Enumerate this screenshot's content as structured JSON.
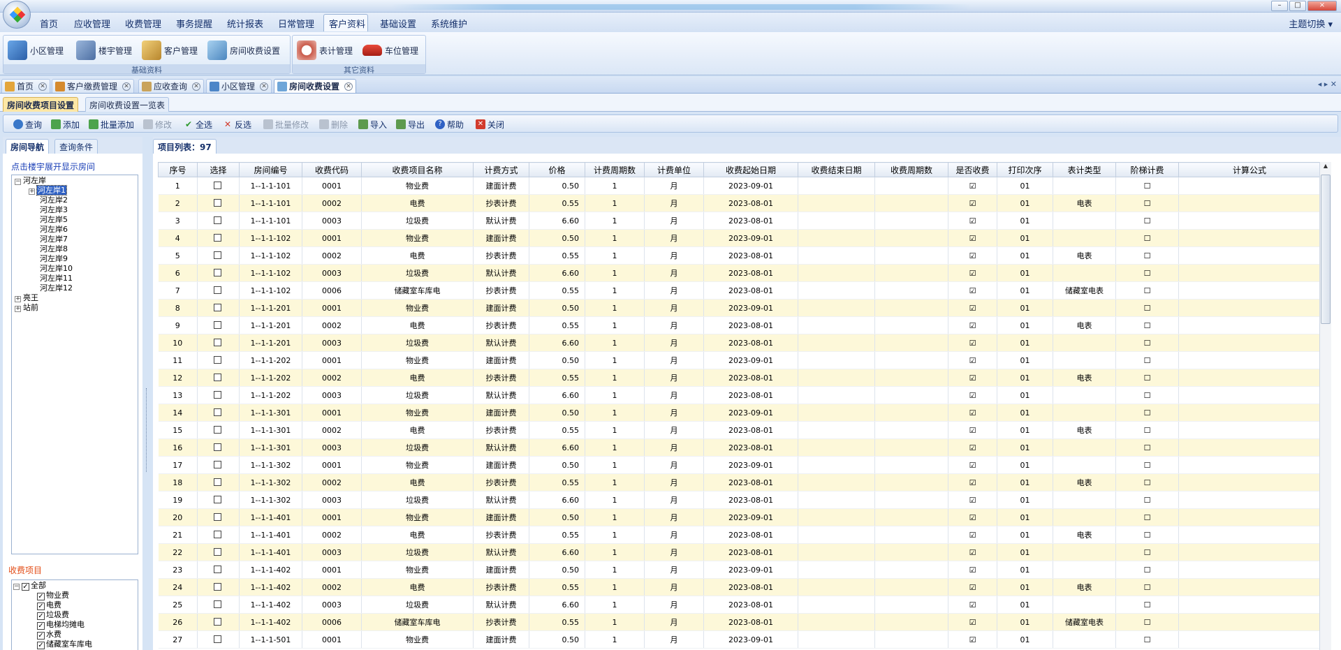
{
  "window": {
    "title": "",
    "buttons": [
      "–",
      "□",
      "×"
    ]
  },
  "menu": {
    "items": [
      "首页",
      "应收管理",
      "收费管理",
      "事务提醒",
      "统计报表",
      "日常管理",
      "客户资料",
      "基础设置",
      "系统维护"
    ],
    "active": "客户资料",
    "theme_switch": "主题切换 ▾"
  },
  "ribbon": {
    "groups": [
      {
        "label": "基础资料",
        "buttons": [
          "小区管理",
          "楼宇管理",
          "客户管理",
          "房间收费设置"
        ]
      },
      {
        "label": "其它资料",
        "buttons": [
          "表计管理",
          "车位管理"
        ]
      }
    ]
  },
  "doc_tabs": [
    "首页",
    "客户缴费管理",
    "应收查询",
    "小区管理",
    "房间收费设置"
  ],
  "doc_tab_close": "✕",
  "doc_nav": "◂ ▸ ✕",
  "sub_tabs": [
    "房间收费项目设置",
    "房间收费设置一览表"
  ],
  "toolbar": {
    "buttons": [
      {
        "label": "查询",
        "enabled": true,
        "icon": "search-icon"
      },
      {
        "label": "添加",
        "enabled": true,
        "icon": "add-icon"
      },
      {
        "label": "批量添加",
        "enabled": true,
        "icon": "batch-add-icon"
      },
      {
        "label": "修改",
        "enabled": false,
        "icon": "edit-icon"
      },
      {
        "label": "全选",
        "enabled": true,
        "icon": "check-icon"
      },
      {
        "label": "反选",
        "enabled": true,
        "icon": "invert-icon"
      },
      {
        "label": "批量修改",
        "enabled": false,
        "icon": "batch-edit-icon"
      },
      {
        "label": "删除",
        "enabled": false,
        "icon": "delete-icon"
      },
      {
        "label": "导入",
        "enabled": true,
        "icon": "import-icon"
      },
      {
        "label": "导出",
        "enabled": true,
        "icon": "export-icon"
      },
      {
        "label": "帮助",
        "enabled": true,
        "icon": "help-icon"
      },
      {
        "label": "关闭",
        "enabled": true,
        "icon": "close-icon"
      }
    ]
  },
  "left_panel": {
    "tabs": [
      "房间导航",
      "查询条件"
    ],
    "hint": "点击楼宇展开显示房间",
    "tree": {
      "root": "河左岸",
      "children": [
        "河左岸1",
        "河左岸2",
        "河左岸3",
        "河左岸5",
        "河左岸6",
        "河左岸7",
        "河左岸8",
        "河左岸9",
        "河左岸10",
        "河左岸11",
        "河左岸12"
      ],
      "selected": "河左岸1",
      "others": [
        "亮王",
        "站前"
      ]
    },
    "fee_label": "收费项目",
    "fee_items": [
      "全部",
      "物业费",
      "电费",
      "垃圾费",
      "电梯均摊电",
      "水费",
      "储藏室车库电"
    ]
  },
  "grid": {
    "tab_label": "项目列表：97",
    "columns": [
      "序号",
      "选择",
      "房间编号",
      "收费代码",
      "收费项目名称",
      "计费方式",
      "价格",
      "计费周期数",
      "计费单位",
      "收费起始日期",
      "收费结束日期",
      "收费周期数",
      "是否收费",
      "打印次序",
      "表计类型",
      "阶梯计费",
      "计算公式"
    ],
    "rows": [
      {
        "no": "1",
        "room": "1--1-1-101",
        "code": "0001",
        "name": "物业费",
        "method": "建面计费",
        "price": "0.50",
        "period": "1",
        "unit": "月",
        "start": "2023-09-01",
        "end": "",
        "cycles": "",
        "charge": "☑",
        "print": "01",
        "meter": "",
        "tier": "☐",
        "formula": ""
      },
      {
        "no": "2",
        "room": "1--1-1-101",
        "code": "0002",
        "name": "电费",
        "method": "抄表计费",
        "price": "0.55",
        "period": "1",
        "unit": "月",
        "start": "2023-08-01",
        "end": "",
        "cycles": "",
        "charge": "☑",
        "print": "01",
        "meter": "电表",
        "tier": "☐",
        "formula": ""
      },
      {
        "no": "3",
        "room": "1--1-1-101",
        "code": "0003",
        "name": "垃圾费",
        "method": "默认计费",
        "price": "6.60",
        "period": "1",
        "unit": "月",
        "start": "2023-08-01",
        "end": "",
        "cycles": "",
        "charge": "☑",
        "print": "01",
        "meter": "",
        "tier": "☐",
        "formula": ""
      },
      {
        "no": "4",
        "room": "1--1-1-102",
        "code": "0001",
        "name": "物业费",
        "method": "建面计费",
        "price": "0.50",
        "period": "1",
        "unit": "月",
        "start": "2023-09-01",
        "end": "",
        "cycles": "",
        "charge": "☑",
        "print": "01",
        "meter": "",
        "tier": "☐",
        "formula": ""
      },
      {
        "no": "5",
        "room": "1--1-1-102",
        "code": "0002",
        "name": "电费",
        "method": "抄表计费",
        "price": "0.55",
        "period": "1",
        "unit": "月",
        "start": "2023-08-01",
        "end": "",
        "cycles": "",
        "charge": "☑",
        "print": "01",
        "meter": "电表",
        "tier": "☐",
        "formula": ""
      },
      {
        "no": "6",
        "room": "1--1-1-102",
        "code": "0003",
        "name": "垃圾费",
        "method": "默认计费",
        "price": "6.60",
        "period": "1",
        "unit": "月",
        "start": "2023-08-01",
        "end": "",
        "cycles": "",
        "charge": "☑",
        "print": "01",
        "meter": "",
        "tier": "☐",
        "formula": ""
      },
      {
        "no": "7",
        "room": "1--1-1-102",
        "code": "0006",
        "name": "储藏室车库电",
        "method": "抄表计费",
        "price": "0.55",
        "period": "1",
        "unit": "月",
        "start": "2023-08-01",
        "end": "",
        "cycles": "",
        "charge": "☑",
        "print": "01",
        "meter": "储藏室电表",
        "tier": "☐",
        "formula": ""
      },
      {
        "no": "8",
        "room": "1--1-1-201",
        "code": "0001",
        "name": "物业费",
        "method": "建面计费",
        "price": "0.50",
        "period": "1",
        "unit": "月",
        "start": "2023-09-01",
        "end": "",
        "cycles": "",
        "charge": "☑",
        "print": "01",
        "meter": "",
        "tier": "☐",
        "formula": ""
      },
      {
        "no": "9",
        "room": "1--1-1-201",
        "code": "0002",
        "name": "电费",
        "method": "抄表计费",
        "price": "0.55",
        "period": "1",
        "unit": "月",
        "start": "2023-08-01",
        "end": "",
        "cycles": "",
        "charge": "☑",
        "print": "01",
        "meter": "电表",
        "tier": "☐",
        "formula": ""
      },
      {
        "no": "10",
        "room": "1--1-1-201",
        "code": "0003",
        "name": "垃圾费",
        "method": "默认计费",
        "price": "6.60",
        "period": "1",
        "unit": "月",
        "start": "2023-08-01",
        "end": "",
        "cycles": "",
        "charge": "☑",
        "print": "01",
        "meter": "",
        "tier": "☐",
        "formula": ""
      },
      {
        "no": "11",
        "room": "1--1-1-202",
        "code": "0001",
        "name": "物业费",
        "method": "建面计费",
        "price": "0.50",
        "period": "1",
        "unit": "月",
        "start": "2023-09-01",
        "end": "",
        "cycles": "",
        "charge": "☑",
        "print": "01",
        "meter": "",
        "tier": "☐",
        "formula": ""
      },
      {
        "no": "12",
        "room": "1--1-1-202",
        "code": "0002",
        "name": "电费",
        "method": "抄表计费",
        "price": "0.55",
        "period": "1",
        "unit": "月",
        "start": "2023-08-01",
        "end": "",
        "cycles": "",
        "charge": "☑",
        "print": "01",
        "meter": "电表",
        "tier": "☐",
        "formula": ""
      },
      {
        "no": "13",
        "room": "1--1-1-202",
        "code": "0003",
        "name": "垃圾费",
        "method": "默认计费",
        "price": "6.60",
        "period": "1",
        "unit": "月",
        "start": "2023-08-01",
        "end": "",
        "cycles": "",
        "charge": "☑",
        "print": "01",
        "meter": "",
        "tier": "☐",
        "formula": ""
      },
      {
        "no": "14",
        "room": "1--1-1-301",
        "code": "0001",
        "name": "物业费",
        "method": "建面计费",
        "price": "0.50",
        "period": "1",
        "unit": "月",
        "start": "2023-09-01",
        "end": "",
        "cycles": "",
        "charge": "☑",
        "print": "01",
        "meter": "",
        "tier": "☐",
        "formula": ""
      },
      {
        "no": "15",
        "room": "1--1-1-301",
        "code": "0002",
        "name": "电费",
        "method": "抄表计费",
        "price": "0.55",
        "period": "1",
        "unit": "月",
        "start": "2023-08-01",
        "end": "",
        "cycles": "",
        "charge": "☑",
        "print": "01",
        "meter": "电表",
        "tier": "☐",
        "formula": ""
      },
      {
        "no": "16",
        "room": "1--1-1-301",
        "code": "0003",
        "name": "垃圾费",
        "method": "默认计费",
        "price": "6.60",
        "period": "1",
        "unit": "月",
        "start": "2023-08-01",
        "end": "",
        "cycles": "",
        "charge": "☑",
        "print": "01",
        "meter": "",
        "tier": "☐",
        "formula": ""
      },
      {
        "no": "17",
        "room": "1--1-1-302",
        "code": "0001",
        "name": "物业费",
        "method": "建面计费",
        "price": "0.50",
        "period": "1",
        "unit": "月",
        "start": "2023-09-01",
        "end": "",
        "cycles": "",
        "charge": "☑",
        "print": "01",
        "meter": "",
        "tier": "☐",
        "formula": ""
      },
      {
        "no": "18",
        "room": "1--1-1-302",
        "code": "0002",
        "name": "电费",
        "method": "抄表计费",
        "price": "0.55",
        "period": "1",
        "unit": "月",
        "start": "2023-08-01",
        "end": "",
        "cycles": "",
        "charge": "☑",
        "print": "01",
        "meter": "电表",
        "tier": "☐",
        "formula": ""
      },
      {
        "no": "19",
        "room": "1--1-1-302",
        "code": "0003",
        "name": "垃圾费",
        "method": "默认计费",
        "price": "6.60",
        "period": "1",
        "unit": "月",
        "start": "2023-08-01",
        "end": "",
        "cycles": "",
        "charge": "☑",
        "print": "01",
        "meter": "",
        "tier": "☐",
        "formula": ""
      },
      {
        "no": "20",
        "room": "1--1-1-401",
        "code": "0001",
        "name": "物业费",
        "method": "建面计费",
        "price": "0.50",
        "period": "1",
        "unit": "月",
        "start": "2023-09-01",
        "end": "",
        "cycles": "",
        "charge": "☑",
        "print": "01",
        "meter": "",
        "tier": "☐",
        "formula": ""
      },
      {
        "no": "21",
        "room": "1--1-1-401",
        "code": "0002",
        "name": "电费",
        "method": "抄表计费",
        "price": "0.55",
        "period": "1",
        "unit": "月",
        "start": "2023-08-01",
        "end": "",
        "cycles": "",
        "charge": "☑",
        "print": "01",
        "meter": "电表",
        "tier": "☐",
        "formula": ""
      },
      {
        "no": "22",
        "room": "1--1-1-401",
        "code": "0003",
        "name": "垃圾费",
        "method": "默认计费",
        "price": "6.60",
        "period": "1",
        "unit": "月",
        "start": "2023-08-01",
        "end": "",
        "cycles": "",
        "charge": "☑",
        "print": "01",
        "meter": "",
        "tier": "☐",
        "formula": ""
      },
      {
        "no": "23",
        "room": "1--1-1-402",
        "code": "0001",
        "name": "物业费",
        "method": "建面计费",
        "price": "0.50",
        "period": "1",
        "unit": "月",
        "start": "2023-09-01",
        "end": "",
        "cycles": "",
        "charge": "☑",
        "print": "01",
        "meter": "",
        "tier": "☐",
        "formula": ""
      },
      {
        "no": "24",
        "room": "1--1-1-402",
        "code": "0002",
        "name": "电费",
        "method": "抄表计费",
        "price": "0.55",
        "period": "1",
        "unit": "月",
        "start": "2023-08-01",
        "end": "",
        "cycles": "",
        "charge": "☑",
        "print": "01",
        "meter": "电表",
        "tier": "☐",
        "formula": ""
      },
      {
        "no": "25",
        "room": "1--1-1-402",
        "code": "0003",
        "name": "垃圾费",
        "method": "默认计费",
        "price": "6.60",
        "period": "1",
        "unit": "月",
        "start": "2023-08-01",
        "end": "",
        "cycles": "",
        "charge": "☑",
        "print": "01",
        "meter": "",
        "tier": "☐",
        "formula": ""
      },
      {
        "no": "26",
        "room": "1--1-1-402",
        "code": "0006",
        "name": "储藏室车库电",
        "method": "抄表计费",
        "price": "0.55",
        "period": "1",
        "unit": "月",
        "start": "2023-08-01",
        "end": "",
        "cycles": "",
        "charge": "☑",
        "print": "01",
        "meter": "储藏室电表",
        "tier": "☐",
        "formula": ""
      },
      {
        "no": "27",
        "room": "1--1-1-501",
        "code": "0001",
        "name": "物业费",
        "method": "建面计费",
        "price": "0.50",
        "period": "1",
        "unit": "月",
        "start": "2023-09-01",
        "end": "",
        "cycles": "",
        "charge": "☑",
        "print": "01",
        "meter": "",
        "tier": "☐",
        "formula": ""
      }
    ]
  },
  "colors": {
    "row_alt": "#fdf8d9",
    "accent": "#2f61c4",
    "fee_label": "#e24b15"
  }
}
